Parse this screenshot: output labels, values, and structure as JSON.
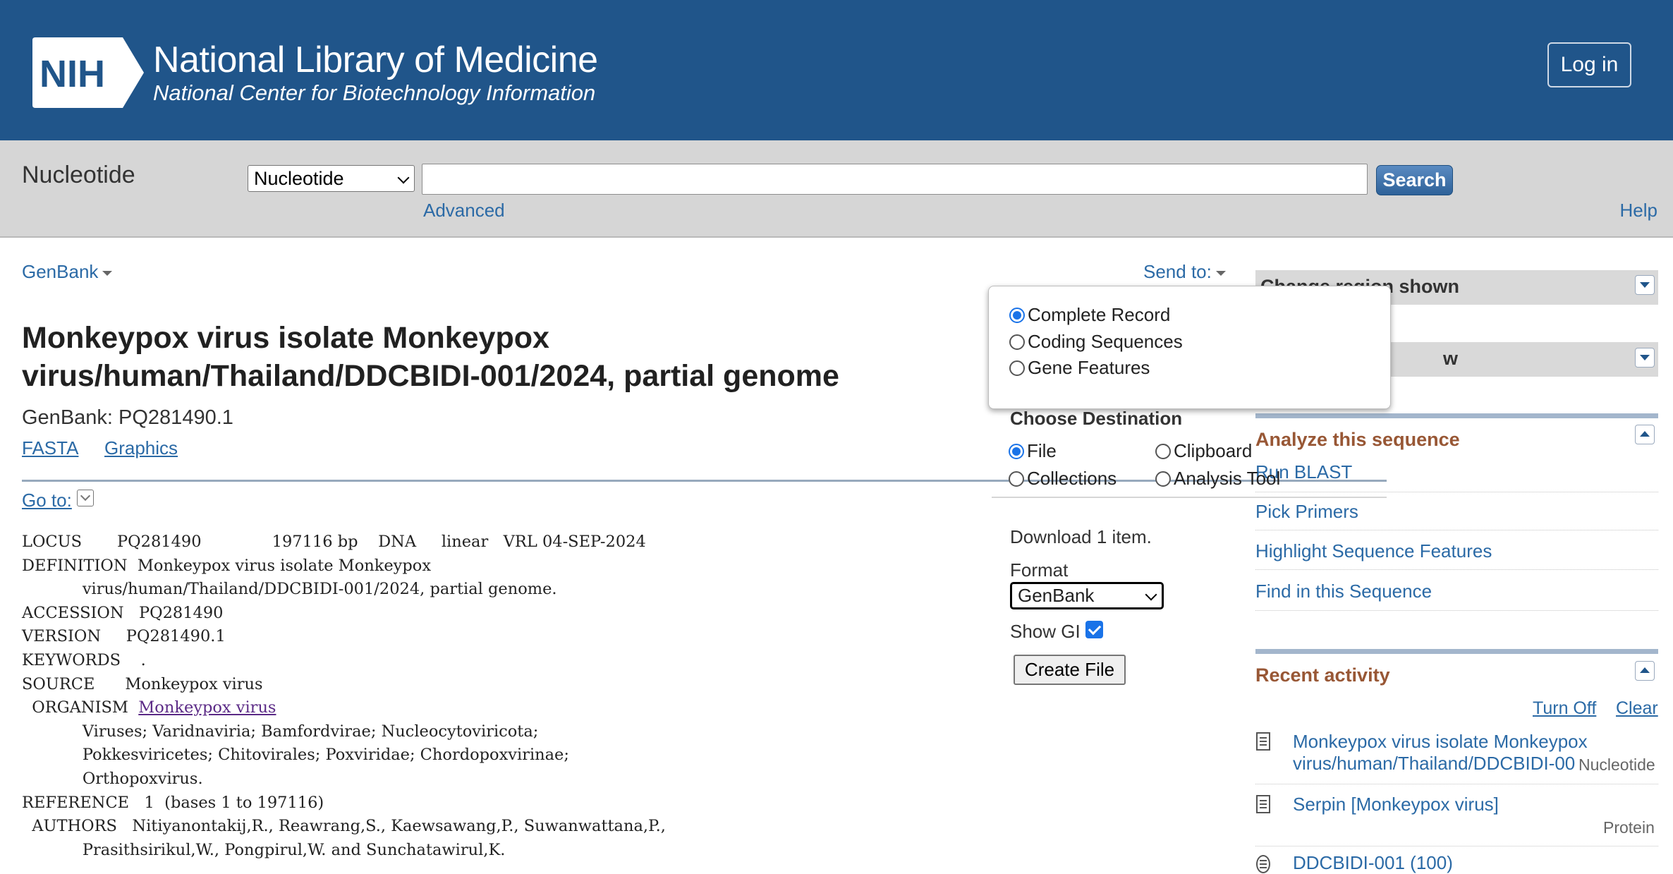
{
  "banner": {
    "logo_text": "NIH",
    "title": "National Library of Medicine",
    "subtitle": "National Center for Biotechnology Information",
    "login_label": "Log in",
    "color": "#20558a"
  },
  "search": {
    "db_name": "Nucleotide",
    "db_selected": "Nucleotide",
    "query": "",
    "search_label": "Search",
    "advanced_label": "Advanced",
    "help_label": "Help"
  },
  "record": {
    "format_menu": "GenBank",
    "send_to_label": "Send to:",
    "title": "Monkeypox virus isolate Monkeypox virus/human/Thailand/DDCBIDI-001/2024, partial genome",
    "accession_line": "GenBank: PQ281490.1",
    "fasta_link": "FASTA",
    "graphics_link": "Graphics",
    "goto_label": "Go to:",
    "flatfile": {
      "locus": "LOCUS       PQ281490              197116 bp    DNA     linear   VRL 04-SEP-2024",
      "definition_1": "DEFINITION  Monkeypox virus isolate Monkeypox",
      "definition_2": "            virus/human/Thailand/DDCBIDI-001/2024, partial genome.",
      "accession": "ACCESSION   PQ281490",
      "version": "VERSION     PQ281490.1",
      "keywords": "KEYWORDS    .",
      "source": "SOURCE      Monkeypox virus",
      "organism_prefix": "  ORGANISM  ",
      "organism_link": "Monkeypox virus",
      "lineage_1": "            Viruses; Varidnaviria; Bamfordvirae; Nucleocytoviricota;",
      "lineage_2": "            Pokkesviricetes; Chitovirales; Poxviridae; Chordopoxvirinae;",
      "lineage_3": "            Orthopoxvirus.",
      "reference": "REFERENCE   1  (bases 1 to 197116)",
      "authors_1": "  AUTHORS   Nitiyanontakij,R., Reawrang,S., Kaewsawang,P., Suwanwattana,P.,",
      "authors_2": "            Prasithsirikul,W., Pongpirul,W. and Sunchatawirul,K."
    }
  },
  "send_to_panel": {
    "record_options": [
      {
        "label": "Complete Record",
        "checked": true
      },
      {
        "label": "Coding Sequences",
        "checked": false
      },
      {
        "label": "Gene Features",
        "checked": false
      }
    ],
    "destination_title": "Choose Destination",
    "destinations": [
      {
        "label": "File",
        "checked": true
      },
      {
        "label": "Clipboard",
        "checked": false
      },
      {
        "label": "Collections",
        "checked": false
      },
      {
        "label": "Analysis Tool",
        "checked": false
      }
    ],
    "download_text": "Download 1 item.",
    "format_label": "Format",
    "format_value": "GenBank",
    "show_gi_label": "Show GI",
    "show_gi_checked": true,
    "create_file_label": "Create File"
  },
  "sidebar": {
    "change_region_title": "Change region shown",
    "customize_view_title_visible": "w",
    "analyze_title": "Analyze this sequence",
    "analyze_links": [
      "Run BLAST",
      "Pick Primers",
      "Highlight Sequence Features",
      "Find in this Sequence"
    ],
    "recent_title": "Recent activity",
    "turn_off_label": "Turn Off",
    "clear_label": "Clear",
    "recent_items": [
      {
        "line1": "Monkeypox virus isolate Monkeypox",
        "line2": "virus/human/Thailand/DDCBIDI-00",
        "type": "Nucleotide"
      },
      {
        "line1": "Serpin [Monkeypox virus]",
        "line2": "",
        "type": "Protein"
      }
    ],
    "recent_cut_item": "DDCBIDI-001 (100)"
  }
}
